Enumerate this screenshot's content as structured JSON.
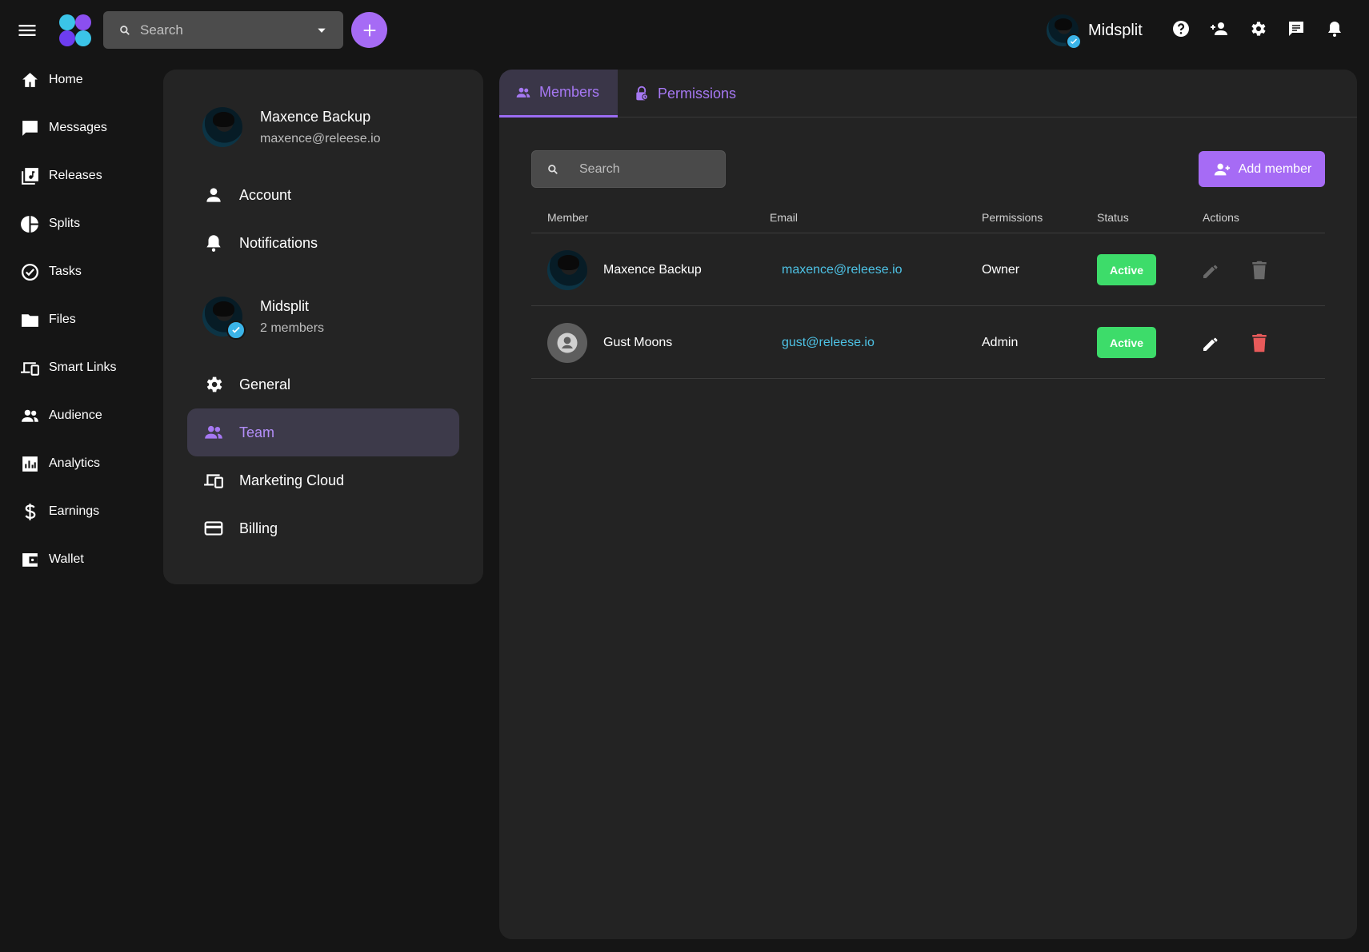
{
  "header": {
    "search": {
      "placeholder": "Search"
    },
    "account": {
      "name": "Midsplit"
    },
    "icons": [
      "menu-icon",
      "logo",
      "search-icon",
      "chevron-down-icon",
      "plus-icon",
      "help-icon",
      "add-person-icon",
      "gear-icon",
      "chat-icon",
      "bell-icon"
    ]
  },
  "sidebar": {
    "items": [
      {
        "label": "Home",
        "icon": "home-icon"
      },
      {
        "label": "Messages",
        "icon": "message-icon"
      },
      {
        "label": "Releases",
        "icon": "library-music-icon"
      },
      {
        "label": "Splits",
        "icon": "pie-chart-icon"
      },
      {
        "label": "Tasks",
        "icon": "check-circle-icon"
      },
      {
        "label": "Files",
        "icon": "folder-icon"
      },
      {
        "label": "Smart Links",
        "icon": "devices-icon"
      },
      {
        "label": "Audience",
        "icon": "people-icon"
      },
      {
        "label": "Analytics",
        "icon": "analytics-icon"
      },
      {
        "label": "Earnings",
        "icon": "dollar-icon"
      },
      {
        "label": "Wallet",
        "icon": "wallet-icon"
      }
    ]
  },
  "settings": {
    "user": {
      "name": "Maxence Backup",
      "email": "maxence@releese.io"
    },
    "user_items": [
      {
        "label": "Account",
        "icon": "person-icon"
      },
      {
        "label": "Notifications",
        "icon": "bell-icon"
      }
    ],
    "team": {
      "name": "Midsplit",
      "members": "2 members"
    },
    "team_items": [
      {
        "label": "General",
        "icon": "gear-icon"
      },
      {
        "label": "Team",
        "icon": "people-icon",
        "active": true
      },
      {
        "label": "Marketing Cloud",
        "icon": "devices-icon"
      },
      {
        "label": "Billing",
        "icon": "credit-card-icon"
      }
    ]
  },
  "main": {
    "tabs": [
      {
        "label": "Members",
        "icon": "people-icon",
        "active": true
      },
      {
        "label": "Permissions",
        "icon": "lock-icon"
      }
    ],
    "search": {
      "placeholder": "Search"
    },
    "add_member_label": "Add member",
    "columns": [
      "Member",
      "Email",
      "Permissions",
      "Status",
      "Actions"
    ],
    "rows": [
      {
        "name": "Maxence Backup",
        "email": "maxence@releese.io",
        "permission": "Owner",
        "status": "Active",
        "actions_enabled": false
      },
      {
        "name": "Gust Moons",
        "email": "gust@releese.io",
        "permission": "Admin",
        "status": "Active",
        "actions_enabled": true
      }
    ]
  },
  "colors": {
    "accent": "#a66bf5",
    "active_badge": "#3ddc6a",
    "link": "#4ec3e6",
    "delete": "#e85a5a",
    "disabled_icon": "#6a6a6a"
  }
}
